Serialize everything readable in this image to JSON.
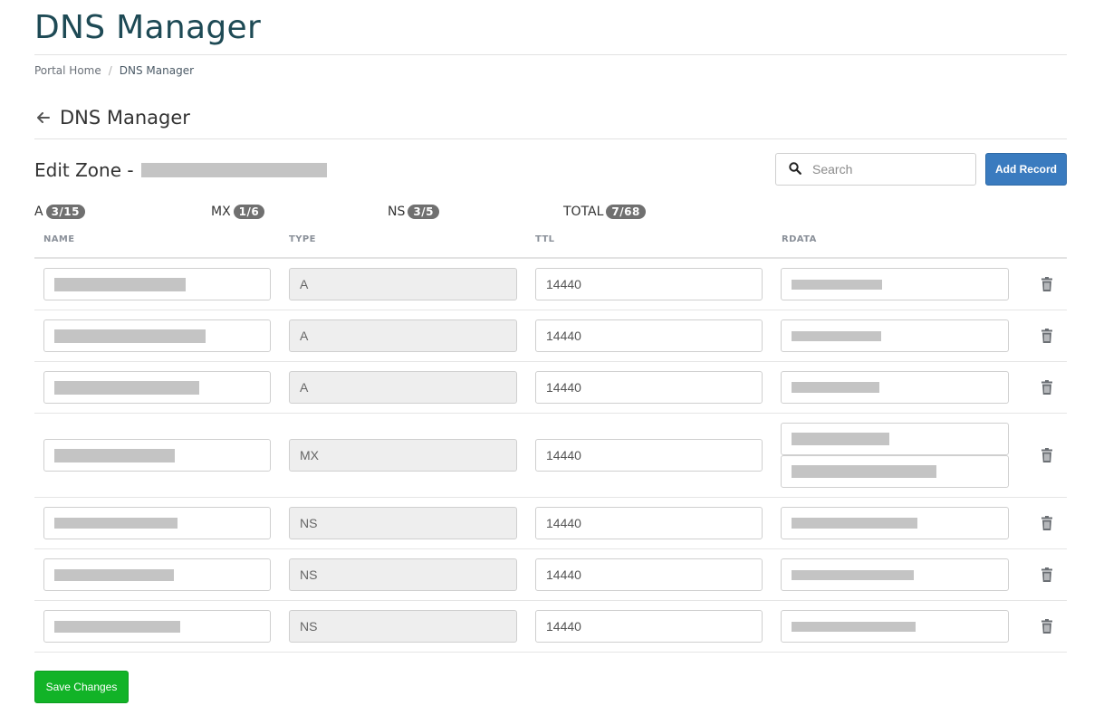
{
  "page": {
    "title": "DNS Manager"
  },
  "breadcrumb": {
    "home": "Portal Home",
    "separator": "/",
    "current": "DNS Manager"
  },
  "subheader": {
    "title": "DNS Manager",
    "back_icon": "arrow-left-icon"
  },
  "zone": {
    "label": "Edit Zone -"
  },
  "search": {
    "placeholder": "Search",
    "icon": "search-icon"
  },
  "buttons": {
    "add_record": "Add Record",
    "save_changes": "Save Changes"
  },
  "counts": [
    {
      "type": "A",
      "badge": "3/15"
    },
    {
      "type": "MX",
      "badge": "1/6"
    },
    {
      "type": "NS",
      "badge": "3/5"
    },
    {
      "type": "TOTAL",
      "badge": "7/68"
    }
  ],
  "table": {
    "headers": {
      "name": "NAME",
      "type": "TYPE",
      "ttl": "TTL",
      "rdata": "RDATA"
    },
    "rows": [
      {
        "type": "A",
        "ttl": "14440",
        "rdata_fields": 1
      },
      {
        "type": "A",
        "ttl": "14440",
        "rdata_fields": 1
      },
      {
        "type": "A",
        "ttl": "14440",
        "rdata_fields": 1
      },
      {
        "type": "MX",
        "ttl": "14440",
        "rdata_fields": 2
      },
      {
        "type": "NS",
        "ttl": "14440",
        "rdata_fields": 1
      },
      {
        "type": "NS",
        "ttl": "14440",
        "rdata_fields": 1
      },
      {
        "type": "NS",
        "ttl": "14440",
        "rdata_fields": 1
      }
    ],
    "delete_icon": "trash-icon"
  },
  "colors": {
    "title": "#1e4a55",
    "add_button": "#3a7bbf",
    "save_button": "#12b327",
    "badge": "#707070"
  }
}
